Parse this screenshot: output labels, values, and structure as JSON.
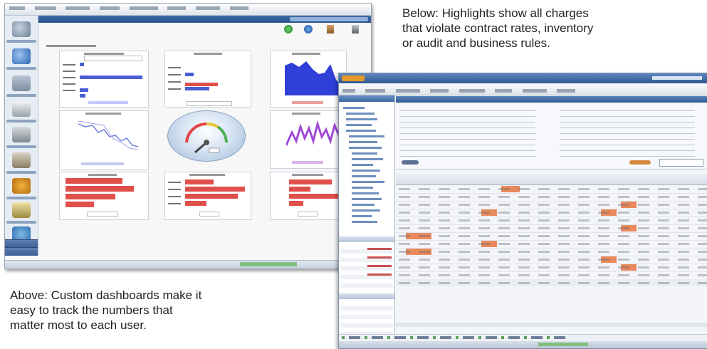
{
  "captions": {
    "below_line1": "Below: Highlights show all charges",
    "below_line2": "that violate contract rates, inventory",
    "below_line3": "or audit and business rules.",
    "above_line1": "Above: Custom dashboards make it",
    "above_line2": "easy to track the numbers that",
    "above_line3": "matter most to each user."
  },
  "colors": {
    "bar_blue": "#4b5ed6",
    "bar_red": "#e0504a",
    "area_blue": "#2f3fd8",
    "line_purple": "#a14ad8",
    "line_blue": "#6f7fe0",
    "highlight_orange": "#e98a5c",
    "window_chrome": "#2b5288"
  }
}
